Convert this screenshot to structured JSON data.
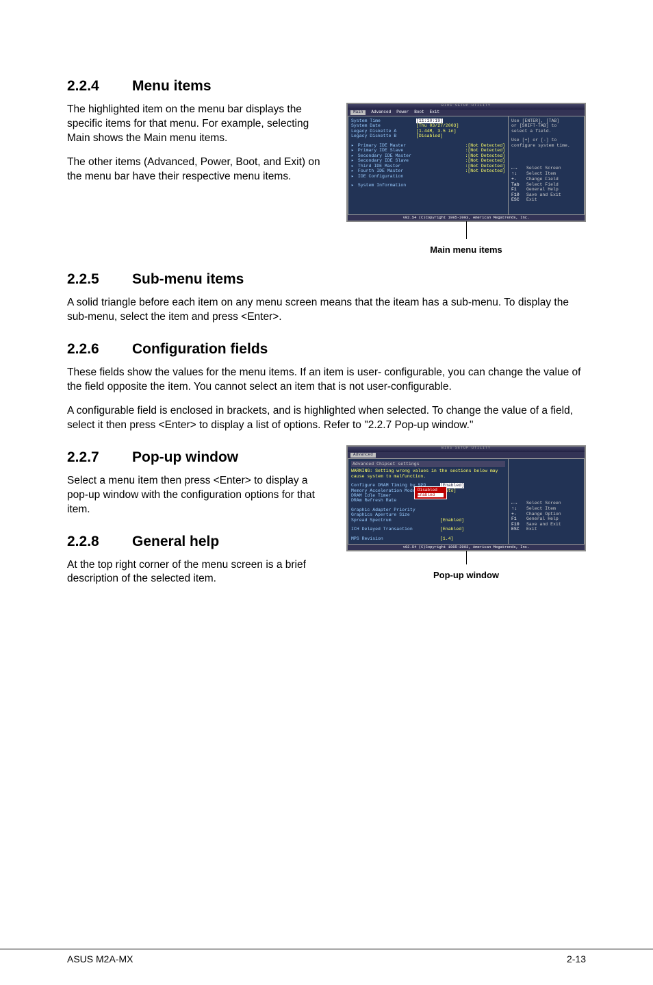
{
  "sections": {
    "s224": {
      "num": "2.2.4",
      "title": "Menu items"
    },
    "s225": {
      "num": "2.2.5",
      "title": "Sub-menu items"
    },
    "s226": {
      "num": "2.2.6",
      "title": "Configuration fields"
    },
    "s227": {
      "num": "2.2.7",
      "title": "Pop-up window"
    },
    "s228": {
      "num": "2.2.8",
      "title": "General help"
    }
  },
  "paras": {
    "p1": "The highlighted item on the menu bar displays the specific items for that menu. For example, selecting Main shows the Main menu items.",
    "p2": "The other items (Advanced, Power, Boot, and Exit) on the menu bar have their respective menu items.",
    "p3": "A solid triangle before each item on any menu screen means that the iteam has a sub-menu. To display the sub-menu, select the item and press <Enter>.",
    "p4": "These fields show the values for the menu items. If an item is user- configurable, you can change the value of the field opposite the item. You cannot select an item that is not user-configurable.",
    "p5": "A configurable field is enclosed in brackets, and is highlighted when selected. To change the value of a field, select it then press <Enter> to display a list of options. Refer to \"2.2.7 Pop-up window.\"",
    "p6": "Select a menu item then press <Enter> to display a pop-up window with the configuration options for that item.",
    "p7": "At the top right corner of the menu screen is a brief description of the selected item."
  },
  "captions": {
    "c1": "Main menu items",
    "c2": "Pop-up window"
  },
  "bios1": {
    "titlebar": "BIOS SETUP UTILITY",
    "tabs": [
      "Main",
      "Advanced",
      "Power",
      "Boot",
      "Exit"
    ],
    "active_tab": "Main",
    "rows": [
      {
        "label": "System Time",
        "val": "[11:10:19]"
      },
      {
        "label": "System Date",
        "val": "[Thu 03/27/2003]"
      },
      {
        "label": "Legacy Diskette A",
        "val": "[1.44M, 3.5 in]"
      },
      {
        "label": "Legacy Diskette B",
        "val": "[Disabled]"
      }
    ],
    "subrows": [
      {
        "label": "Primary IDE Master",
        "val": ":[Not Detected]"
      },
      {
        "label": "Primary IDE Slave",
        "val": ":[Not Detected]"
      },
      {
        "label": "Secondary IDE Master",
        "val": ":[Not Detected]"
      },
      {
        "label": "Secondary IDE Slave",
        "val": ":[Not Detected]"
      },
      {
        "label": "Third IDE Master",
        "val": ":[Not Detected]"
      },
      {
        "label": "Fourth IDE Master",
        "val": ":[Not Detected]"
      },
      {
        "label": "IDE Configuration",
        "val": ""
      }
    ],
    "sysinfo": "System Information",
    "side_top": [
      "Use [ENTER], [TAB]",
      "or [SHIFT-TAB] to",
      "select a field.",
      "",
      "Use [+] or [-] to",
      "configure system time."
    ],
    "side_help": [
      {
        "key": "←→",
        "txt": "Select Screen"
      },
      {
        "key": "↑↓",
        "txt": "Select Item"
      },
      {
        "key": "+-",
        "txt": "Change Field"
      },
      {
        "key": "Tab",
        "txt": "Select Field"
      },
      {
        "key": "F1",
        "txt": "General Help"
      },
      {
        "key": "F10",
        "txt": "Save and Exit"
      },
      {
        "key": "ESC",
        "txt": "Exit"
      }
    ],
    "foot": "v02.54 (C)Copyright 1985-2003, American Megatrends, Inc."
  },
  "bios2": {
    "titlebar": "BIOS SETUP UTILITY",
    "tabs_active": "Advanced",
    "header": "Advanced Chipset settings",
    "warning": "WARNING: Setting wrong values in the sections below may cause system to malfunction.",
    "rows": [
      {
        "label": "Configure DRAM Timing by SPD",
        "val": "[Enabled]"
      },
      {
        "label": "Memory Acceleration Mode",
        "val": "[Auto]"
      },
      {
        "label": "DRAM Idle Timer",
        "val": ""
      },
      {
        "label": "DRAm Refresh Rate",
        "val": ""
      }
    ],
    "rows2": [
      {
        "label": "Graphic Adapter Priority",
        "val": ""
      },
      {
        "label": "Graphics Aperture Size",
        "val": ""
      },
      {
        "label": "Spread Spectrum",
        "val": "[Enabled]"
      }
    ],
    "rows3": [
      {
        "label": "ICH Delayed Transaction",
        "val": "[Enabled]"
      }
    ],
    "rows4": [
      {
        "label": "MPS Revision",
        "val": "[1.4]"
      }
    ],
    "popup": [
      "Disabled",
      "Enabled"
    ],
    "side_help": [
      {
        "key": "←→",
        "txt": "Select Screen"
      },
      {
        "key": "↑↓",
        "txt": "Select Item"
      },
      {
        "key": "+-",
        "txt": "Change Option"
      },
      {
        "key": "F1",
        "txt": "General Help"
      },
      {
        "key": "F10",
        "txt": "Save and Exit"
      },
      {
        "key": "ESC",
        "txt": "Exit"
      }
    ],
    "foot": "v02.54 (C)Copyright 1985-2003, American Megatrends, Inc."
  },
  "footer": {
    "left": "ASUS M2A-MX",
    "right": "2-13"
  }
}
